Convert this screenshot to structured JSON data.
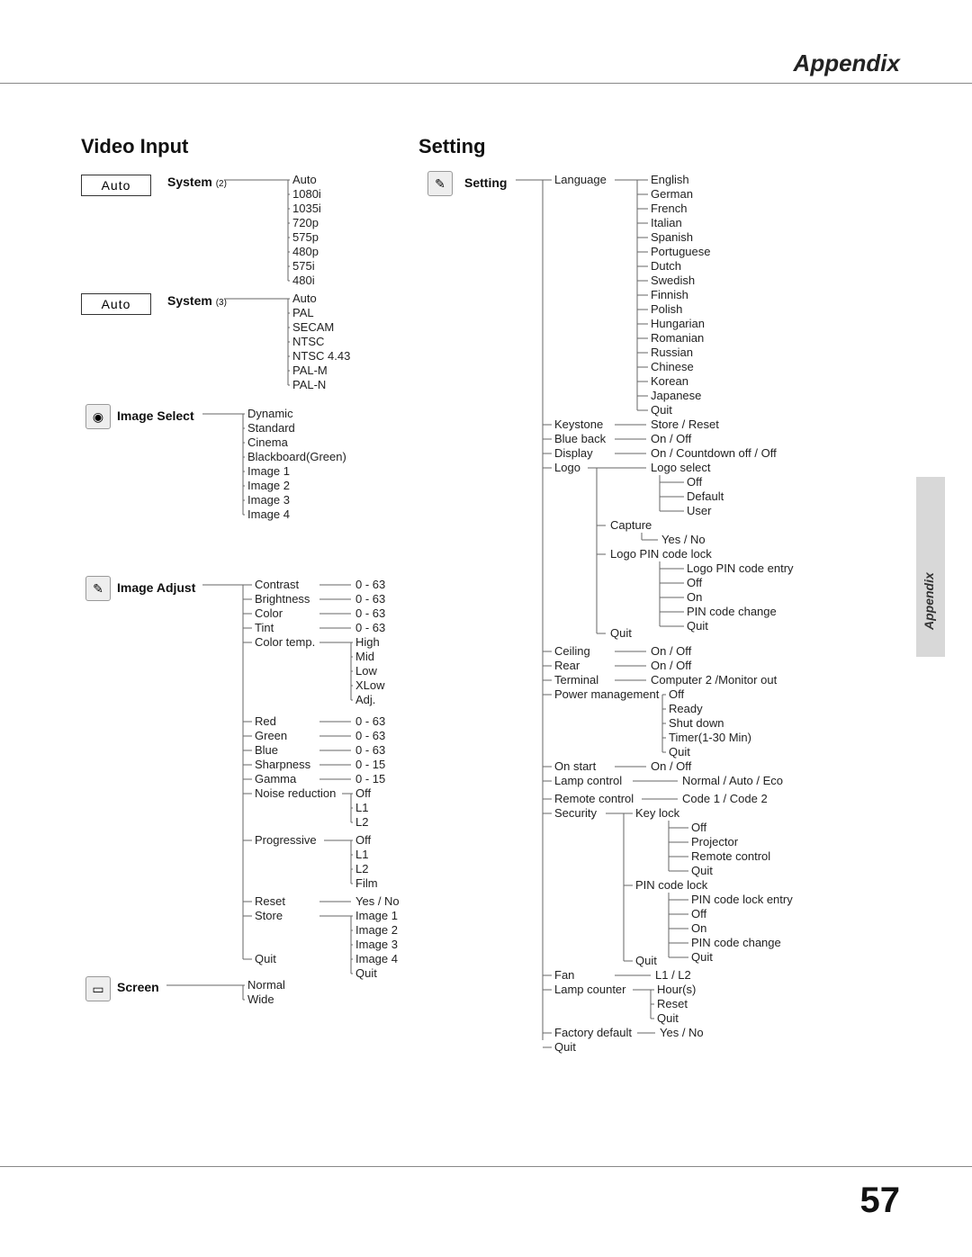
{
  "header": "Appendix",
  "side_tab": "Appendix",
  "page_number": "57",
  "video": {
    "title": "Video Input",
    "auto_box2": "Auto",
    "auto_box3": "Auto",
    "system2_label": "System",
    "system2_ref": "(2)",
    "system2_items": [
      "Auto",
      "1080i",
      "1035i",
      "720p",
      "575p",
      "480p",
      "575i",
      "480i"
    ],
    "system3_label": "System",
    "system3_ref": "(3)",
    "system3_items": [
      "Auto",
      "PAL",
      "SECAM",
      "NTSC",
      "NTSC 4.43",
      "PAL-M",
      "PAL-N"
    ],
    "image_select_label": "Image Select",
    "image_select_items": [
      "Dynamic",
      "Standard",
      "Cinema",
      "Blackboard(Green)",
      "Image 1",
      "Image 2",
      "Image 3",
      "Image 4"
    ],
    "image_adjust_label": "Image Adjust",
    "ia": {
      "contrast": "Contrast",
      "contrast_r": "0 - 63",
      "brightness": "Brightness",
      "brightness_r": "0 - 63",
      "color": "Color",
      "color_r": "0 - 63",
      "tint": "Tint",
      "tint_r": "0 - 63",
      "colortemp": "Color temp.",
      "colortemp_items": [
        "High",
        "Mid",
        "Low",
        "XLow",
        "Adj."
      ],
      "red": "Red",
      "red_r": "0 - 63",
      "green": "Green",
      "green_r": "0 - 63",
      "blue": "Blue",
      "blue_r": "0 - 63",
      "sharpness": "Sharpness",
      "sharpness_r": "0 - 15",
      "gamma": "Gamma",
      "gamma_r": "0 - 15",
      "noise": "Noise reduction",
      "noise_items": [
        "Off",
        "L1",
        "L2"
      ],
      "progressive": "Progressive",
      "progressive_items": [
        "Off",
        "L1",
        "L2",
        "Film"
      ],
      "reset": "Reset",
      "reset_r": "Yes / No",
      "store": "Store",
      "store_items": [
        "Image 1",
        "Image 2",
        "Image 3",
        "Image 4",
        "Quit"
      ],
      "quit": "Quit"
    },
    "screen_label": "Screen",
    "screen_items": [
      "Normal",
      "Wide"
    ]
  },
  "setting": {
    "title": "Setting",
    "label": "Setting",
    "language": "Language",
    "language_items": [
      "English",
      "German",
      "French",
      "Italian",
      "Spanish",
      "Portuguese",
      "Dutch",
      "Swedish",
      "Finnish",
      "Polish",
      "Hungarian",
      "Romanian",
      "Russian",
      "Chinese",
      "Korean",
      "Japanese",
      "Quit"
    ],
    "keystone": "Keystone",
    "keystone_r": "Store / Reset",
    "blueback": "Blue back",
    "blueback_r": "On / Off",
    "display": "Display",
    "display_r": "On / Countdown off / Off",
    "logo": "Logo",
    "logo_select": "Logo select",
    "logo_select_items": [
      "Off",
      "Default",
      "User"
    ],
    "capture": "Capture",
    "capture_r": "Yes / No",
    "logopin": "Logo PIN code lock",
    "logopin_items": [
      "Logo PIN code entry",
      "Off",
      "On",
      "PIN code change",
      "Quit"
    ],
    "logo_quit": "Quit",
    "ceiling": "Ceiling",
    "ceiling_r": "On / Off",
    "rear": "Rear",
    "rear_r": "On / Off",
    "terminal": "Terminal",
    "terminal_r": "Computer 2 /Monitor out",
    "pm": "Power management",
    "pm_items": [
      "Off",
      "Ready",
      "Shut down",
      "Timer(1-30 Min)",
      "Quit"
    ],
    "onstart": "On start",
    "onstart_r": "On / Off",
    "lampctrl": "Lamp control",
    "lampctrl_r": "Normal / Auto / Eco",
    "remote": "Remote control",
    "remote_r": "Code 1 / Code 2",
    "security": "Security",
    "keylock": "Key lock",
    "keylock_items": [
      "Off",
      "Projector",
      "Remote control",
      "Quit"
    ],
    "pincode": "PIN code lock",
    "pincode_items": [
      "PIN code lock entry",
      "Off",
      "On",
      "PIN code change",
      "Quit"
    ],
    "sec_quit": "Quit",
    "fan": "Fan",
    "fan_r": "L1 / L2",
    "lampcounter": "Lamp counter",
    "lampcounter_items": [
      "Hour(s)",
      "Reset",
      "Quit"
    ],
    "factory": "Factory default",
    "factory_r": "Yes / No",
    "quit": "Quit"
  }
}
